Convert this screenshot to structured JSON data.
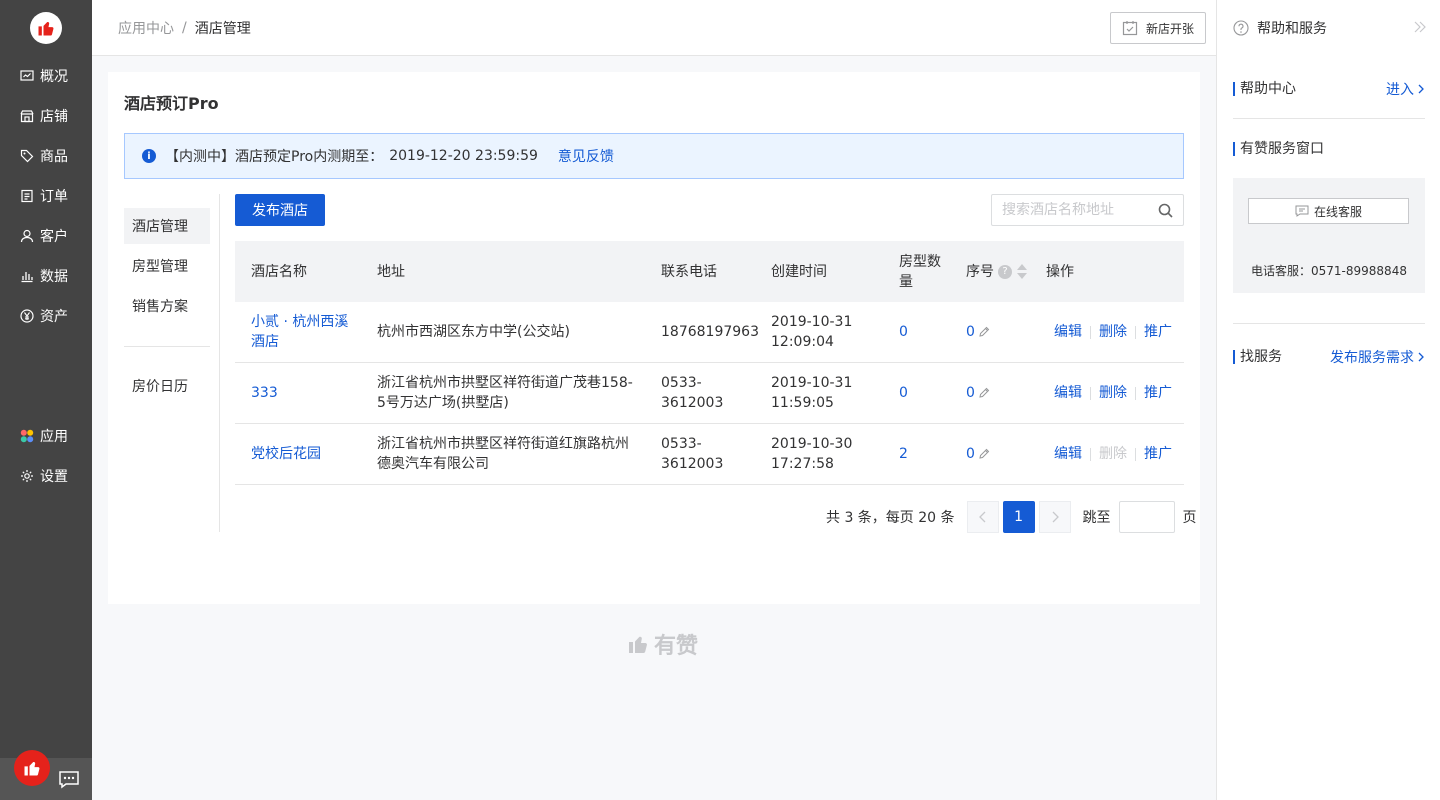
{
  "nav": {
    "items": [
      {
        "label": "概况",
        "icon": "overview-icon"
      },
      {
        "label": "店铺",
        "icon": "store-icon"
      },
      {
        "label": "商品",
        "icon": "tag-icon"
      },
      {
        "label": "订单",
        "icon": "order-icon"
      },
      {
        "label": "客户",
        "icon": "customer-icon"
      },
      {
        "label": "数据",
        "icon": "chart-icon"
      },
      {
        "label": "资产",
        "icon": "yuan-icon"
      },
      {
        "label": "应用",
        "icon": "apps-icon"
      },
      {
        "label": "设置",
        "icon": "settings-icon"
      }
    ]
  },
  "breadcrumb": {
    "parent": "应用中心",
    "separator": "/",
    "current": "酒店管理"
  },
  "topbar": {
    "new_store_label": "新店开张"
  },
  "help": {
    "title": "帮助和服务",
    "help_center": "帮助中心",
    "enter": "进入",
    "service_window": "有赞服务窗口",
    "online_service": "在线客服",
    "phone": "电话客服：0571-89988848",
    "find_service": "找服务",
    "post_demand": "发布服务需求"
  },
  "page": {
    "title": "酒店预订Pro",
    "notice_text": "【内测中】酒店预定Pro内测期至：",
    "notice_date": "2019-12-20 23:59:59",
    "notice_link": "意见反馈",
    "publish_label": "发布酒店",
    "search_placeholder": "搜索酒店名称地址"
  },
  "sidemenu": {
    "items": [
      "酒店管理",
      "房型管理",
      "销售方案"
    ],
    "calendar": "房价日历"
  },
  "table": {
    "headers": {
      "name": "酒店名称",
      "address": "地址",
      "phone": "联系电话",
      "created": "创建时间",
      "rooms": "房型数量",
      "seq": "序号",
      "ops": "操作"
    },
    "rows": [
      {
        "name": "小贰 · 杭州西溪酒店",
        "address": "杭州市西湖区东方中学(公交站)",
        "phone": "18768197963",
        "created": "2019-10-31 12:09:04",
        "rooms": "0",
        "seq": "0",
        "edit": "编辑",
        "delete": "删除",
        "promote": "推广"
      },
      {
        "name": "333",
        "address": "浙江省杭州市拱墅区祥符街道广茂巷158-5号万达广场(拱墅店)",
        "phone": "0533-3612003",
        "created": "2019-10-31 11:59:05",
        "rooms": "0",
        "seq": "0",
        "edit": "编辑",
        "delete": "删除",
        "promote": "推广"
      },
      {
        "name": "党校后花园",
        "address": "浙江省杭州市拱墅区祥符街道红旗路杭州德奥汽车有限公司",
        "phone": "0533-3612003",
        "created": "2019-10-30 17:27:58",
        "rooms": "2",
        "seq": "0",
        "edit": "编辑",
        "delete": "删除",
        "promote": "推广"
      }
    ]
  },
  "pager": {
    "total": "共 3 条，每页 20 条",
    "page": "1",
    "jump": "跳至",
    "page_unit": "页"
  },
  "footer": {
    "brand": "有赞"
  },
  "colors": {
    "accent": "#155bd4",
    "nav_bg": "#444444",
    "brand_red": "#e5221b"
  }
}
